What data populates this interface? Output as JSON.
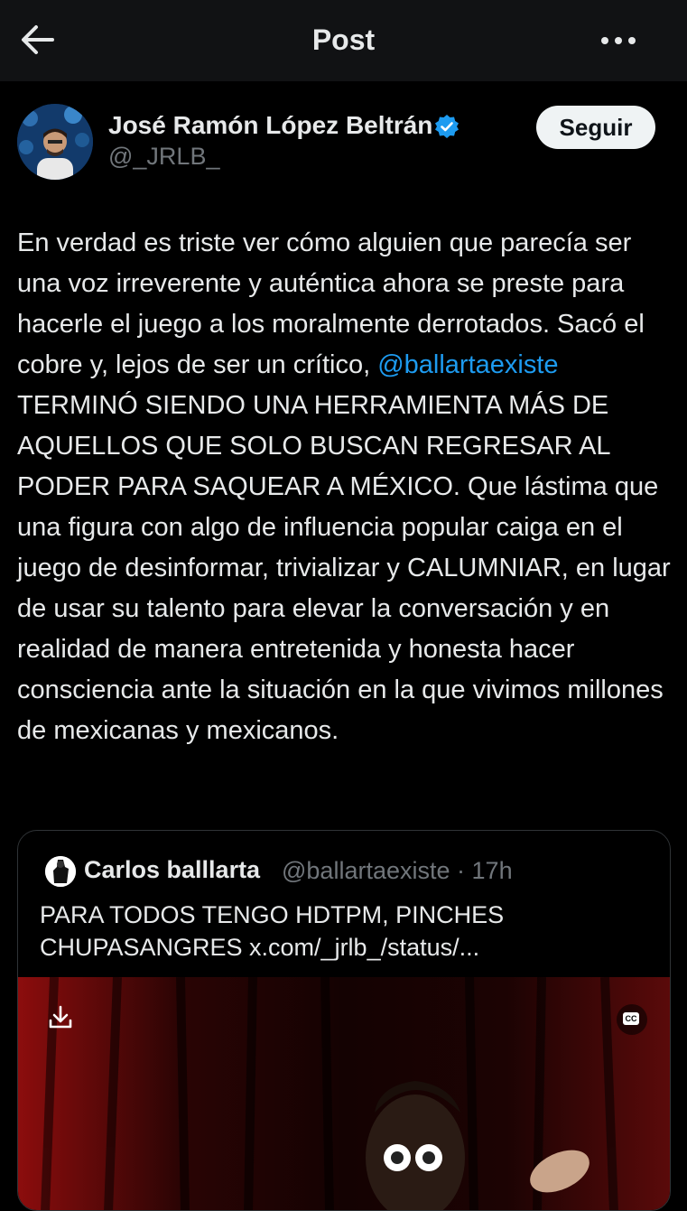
{
  "header": {
    "title": "Post",
    "back_icon": "arrow-left-icon",
    "more_icon": "more-horizontal-icon"
  },
  "post": {
    "author_name": "José Ramón López Beltrán",
    "author_handle": "@_JRLB_",
    "verified_icon": "verified-badge-icon",
    "follow_label": "Seguir",
    "text_before": "En verdad es triste ver cómo alguien que parecía ser una voz irreverente y auténtica ahora se preste para hacerle el juego a los moralmente derrotados. Sacó el cobre y, lejos de ser un crítico, ",
    "mention": "@ballartaexiste",
    "text_after": " TERMINÓ SIENDO UNA HERRAMIENTA MÁS DE AQUELLOS QUE SOLO BUSCAN REGRESAR AL PODER PARA SAQUEAR A MÉXICO. Que lástima que una figura con algo de influencia popular caiga en el juego de desinformar, trivializar y CALUMNIAR, en lugar de usar su talento para elevar la conversación y en realidad de manera entretenida y honesta hacer consciencia ante la situación en la que vivimos millones de mexicanas y mexicanos."
  },
  "quote": {
    "author_name": "Carlos balllarta",
    "author_handle": "@ballartaexiste",
    "separator": "·",
    "time": "17h",
    "text": "PARA TODOS TENGO HDTPM, PINCHES CHUPASANGRES x.com/_jrlb_/status/...",
    "download_icon": "download-icon",
    "cc_icon": "closed-captions-icon",
    "cc_label": "CC"
  },
  "colors": {
    "accent": "#1d9bf0",
    "background": "#000000",
    "text": "#e7e9ea",
    "muted": "#71767b"
  }
}
